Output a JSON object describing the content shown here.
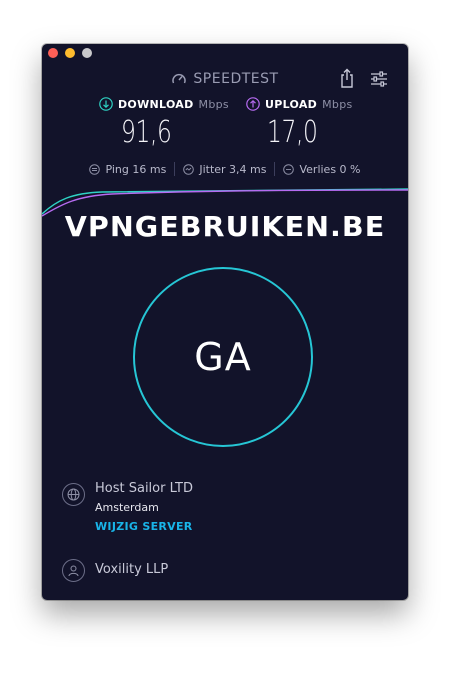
{
  "app": {
    "brand": "SPEEDTEST"
  },
  "download": {
    "label": "DOWNLOAD",
    "unit": "Mbps",
    "value": "91,6",
    "color": "#2ed3c4"
  },
  "upload": {
    "label": "UPLOAD",
    "unit": "Mbps",
    "value": "17,0",
    "color": "#b66bf1"
  },
  "stats": {
    "ping": "Ping 16 ms",
    "jitter": "Jitter 3,4 ms",
    "loss": "Verlies 0 %"
  },
  "watermark": "VPNGEBRUIKEN.BE",
  "go_button": {
    "label": "GA",
    "ring_color": "#26c6d5"
  },
  "server": {
    "host": "Host Sailor LTD",
    "location": "Amsterdam",
    "change_label": "WIJZIG SERVER",
    "change_color": "#19b4e8"
  },
  "provider": {
    "name": "Voxility LLP"
  },
  "icons": {
    "logo": "gauge-icon",
    "share": "share-icon",
    "settings": "sliders-icon",
    "download": "download-arrow-icon",
    "upload": "upload-arrow-icon",
    "ping": "ping-icon",
    "jitter": "jitter-icon",
    "loss": "loss-icon",
    "server": "globe-icon",
    "provider": "user-icon"
  }
}
